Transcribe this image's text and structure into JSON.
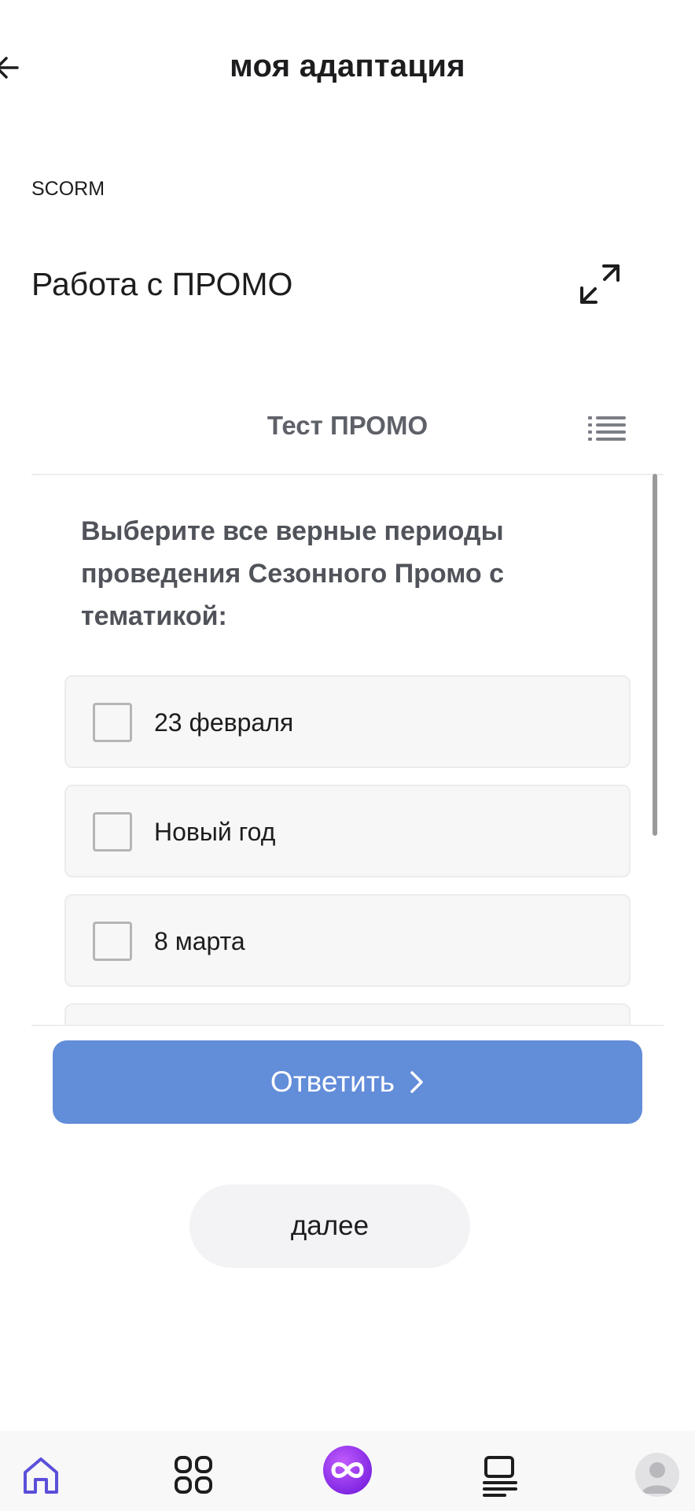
{
  "header": {
    "title": "моя адаптация",
    "back_icon": "arrow-left-icon"
  },
  "module": {
    "type_label": "SCORM",
    "title": "Работа с ПРОМО",
    "expand_icon": "expand-arrows-icon"
  },
  "test": {
    "title": "Тест ПРОМО",
    "menu_icon": "list-icon",
    "question": "Выберите все верные периоды проведения Сезонного Промо с тематикой:",
    "options": [
      {
        "label": "23 февраля",
        "checked": false
      },
      {
        "label": "Новый год",
        "checked": false
      },
      {
        "label": "8 марта",
        "checked": false
      }
    ],
    "answer_button": "Ответить"
  },
  "next_button": "далее",
  "bottom_nav": {
    "items": [
      "home-icon",
      "apps-grid-icon",
      "infinity-logo-icon",
      "catalog-icon",
      "profile-avatar"
    ],
    "active": "home-icon"
  },
  "colors": {
    "accent_button": "#628dd9",
    "active_nav": "#5b4fd9",
    "logo_gradient_start": "#b44bff",
    "logo_gradient_end": "#7a22e0"
  }
}
